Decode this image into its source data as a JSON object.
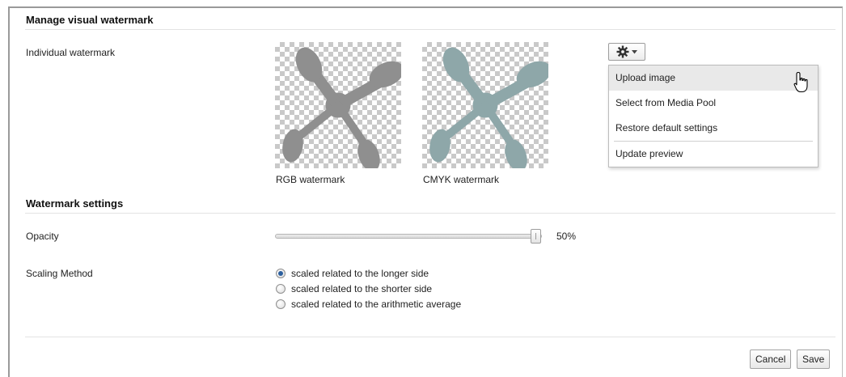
{
  "manage": {
    "title": "Manage visual watermark",
    "individual_label": "Individual watermark",
    "rgb_caption": "RGB watermark",
    "cmyk_caption": "CMYK watermark"
  },
  "colors": {
    "rgb_shape": "#8f8f8f",
    "cmyk_shape": "#8ea7a9",
    "accent": "#2c5f9e"
  },
  "menu": {
    "button_icon": "gear-icon",
    "items": [
      "Upload image",
      "Select from Media Pool",
      "Restore default settings",
      "Update preview"
    ],
    "hovered": "Upload image"
  },
  "settings": {
    "title": "Watermark settings",
    "opacity_label": "Opacity",
    "opacity_value": "50%",
    "opacity_fraction": 1.0,
    "scaling_label": "Scaling Method",
    "scaling_options": [
      "scaled related to the longer side",
      "scaled related to the shorter side",
      "scaled related to the arithmetic average"
    ],
    "scaling_selected": "scaled related to the longer side"
  },
  "footer": {
    "cancel_label": "Cancel",
    "save_label": "Save"
  }
}
